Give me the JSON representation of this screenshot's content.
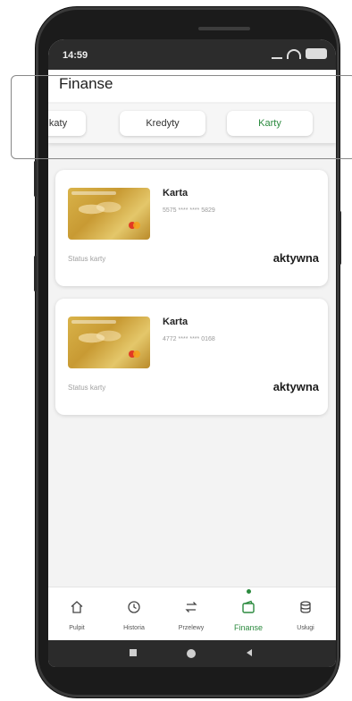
{
  "status_bar": {
    "time": "14:59"
  },
  "header": {
    "title": "Finanse"
  },
  "tabs": [
    {
      "label": "katy"
    },
    {
      "label": "Kredyty"
    },
    {
      "label": "Karty"
    }
  ],
  "cards": [
    {
      "name": "Karta",
      "number": "5575 **** **** 5829",
      "status_label": "Status karty",
      "status_value": "aktywna"
    },
    {
      "name": "Karta",
      "number": "4772 **** **** 0168",
      "status_label": "Status karty",
      "status_value": "aktywna"
    }
  ],
  "bottom_nav": [
    {
      "label": "Pulpit",
      "icon": "home-icon"
    },
    {
      "label": "Historia",
      "icon": "history-icon"
    },
    {
      "label": "Przelewy",
      "icon": "transfer-icon"
    },
    {
      "label": "Finanse",
      "icon": "wallet-icon"
    },
    {
      "label": "Usługi",
      "icon": "services-icon"
    }
  ],
  "colors": {
    "accent": "#2b8a3e",
    "status_bar": "#2c2c2c",
    "background": "#f3f3f3"
  }
}
